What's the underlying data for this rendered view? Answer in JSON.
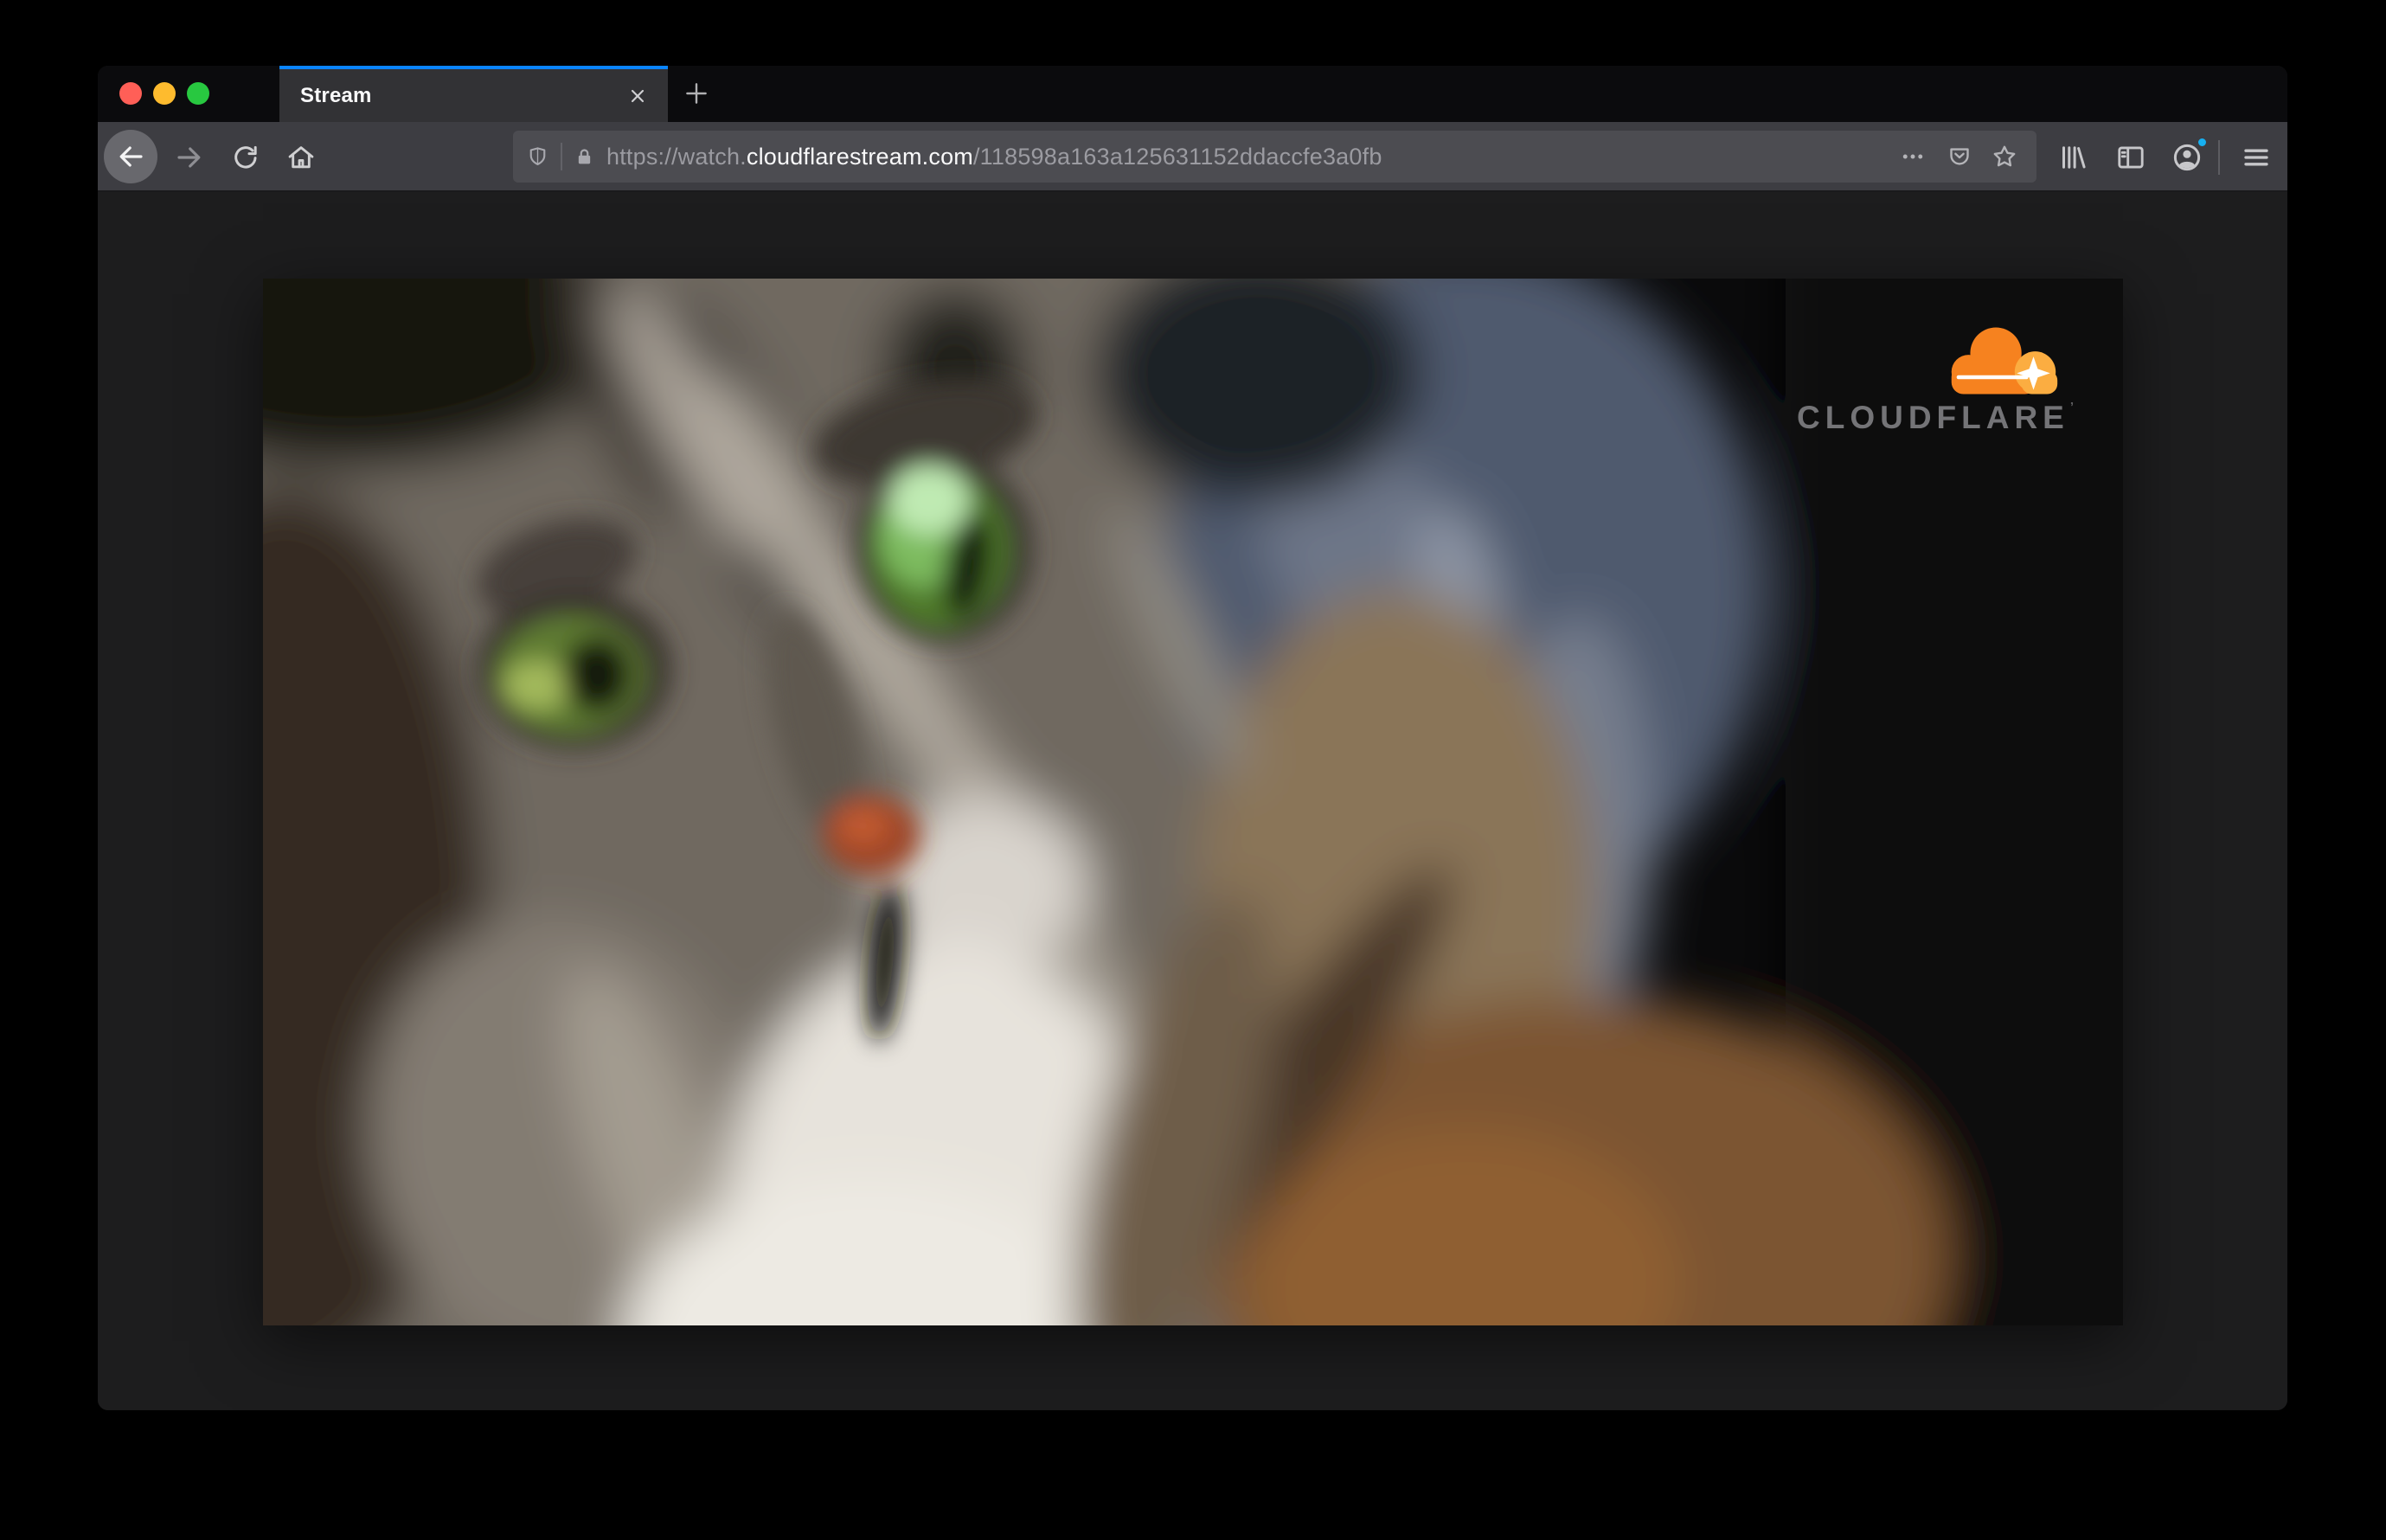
{
  "browser": {
    "traffic_lights": [
      {
        "name": "close",
        "color": "#ff5f57"
      },
      {
        "name": "minimize",
        "color": "#febb2e"
      },
      {
        "name": "zoom",
        "color": "#28c840"
      }
    ],
    "tab": {
      "label": "Stream"
    },
    "accent_color": "#0a84ff",
    "url": {
      "prefix": "https://watch.",
      "host": "cloudflarestream.com",
      "path": "/118598a163a125631152ddaccfe3a0fb"
    }
  },
  "video_page": {
    "logo_text": "CLOUDFLARE",
    "logo_mark": "’",
    "logo_colors": {
      "cloud_main": "#f6821f",
      "cloud_light": "#fbad41",
      "text": "#747477"
    },
    "video_subject": "blurred close-up of a gray tabby cat with green eyes"
  },
  "icons": [
    "back-icon",
    "forward-icon",
    "reload-icon",
    "home-icon",
    "shield-icon",
    "lock-icon",
    "ellipsis-icon",
    "pocket-icon",
    "star-icon",
    "library-icon",
    "sidebar-icon",
    "profile-icon",
    "menu-icon",
    "close-icon",
    "plus-icon",
    "cloudflare-cloud-icon"
  ]
}
